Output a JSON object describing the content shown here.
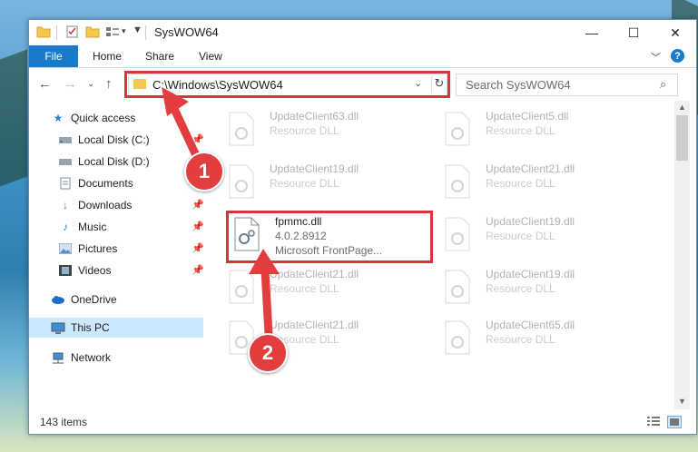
{
  "window": {
    "title": "SysWOW64",
    "controls": {
      "minimize": "—",
      "maximize": "☐",
      "close": "✕"
    }
  },
  "ribbon": {
    "file_tab": "File",
    "tabs": [
      "Home",
      "Share",
      "View"
    ],
    "help": "?"
  },
  "address": {
    "path": "C:\\Windows\\SysWOW64",
    "search_placeholder": "Search SysWOW64"
  },
  "nav_pane": {
    "items": [
      {
        "label": "Quick access",
        "icon": "star-icon"
      },
      {
        "label": "Local Disk (C:)",
        "icon": "drive-icon"
      },
      {
        "label": "Local Disk (D:)",
        "icon": "drive-icon"
      },
      {
        "label": "Documents",
        "icon": "documents-icon"
      },
      {
        "label": "Downloads",
        "icon": "downloads-icon"
      },
      {
        "label": "Music",
        "icon": "music-icon"
      },
      {
        "label": "Pictures",
        "icon": "pictures-icon"
      },
      {
        "label": "Videos",
        "icon": "videos-icon"
      },
      {
        "label": "OneDrive",
        "icon": "cloud-icon"
      },
      {
        "label": "This PC",
        "icon": "computer-icon"
      },
      {
        "label": "Network",
        "icon": "network-icon"
      }
    ]
  },
  "files": {
    "left_column": [
      {
        "name": "UpdateClient63.dll",
        "type": "Resource DLL"
      },
      {
        "name": "UpdateClient19.dll",
        "type": "Resource DLL"
      },
      {
        "name": "fpmmc.dll",
        "version": "4.0.2.8912",
        "description": "Microsoft FrontPage..."
      },
      {
        "name": "UpdateClient21.dll",
        "type": "Resource DLL"
      },
      {
        "name": "UpdateClient21.dll",
        "type": "Resource DLL"
      }
    ],
    "right_column": [
      {
        "name": "UpdateClient5.dll",
        "type": "Resource DLL"
      },
      {
        "name": "UpdateClient21.dll",
        "type": "Resource DLL"
      },
      {
        "name": "UpdateClient19.dll",
        "type": "Resource DLL"
      },
      {
        "name": "UpdateClient19.dll",
        "type": "Resource DLL"
      },
      {
        "name": "UpdateClient65.dll",
        "type": "Resource DLL"
      }
    ]
  },
  "status": {
    "item_count": "143 items"
  },
  "callouts": {
    "step1": "1",
    "step2": "2"
  },
  "colors": {
    "accent": "#1979ca",
    "highlight": "#d6363a",
    "selected": "#cce8ff",
    "folder": "#f3c84e"
  }
}
